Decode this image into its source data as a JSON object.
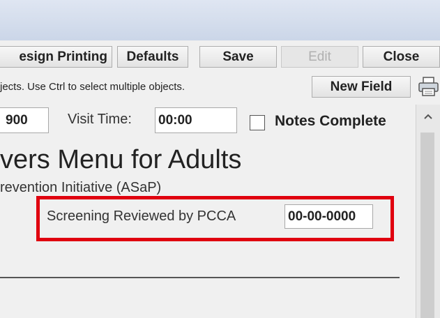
{
  "toolbar": {
    "design_printing_label": "esign Printing",
    "defaults_label": "Defaults",
    "save_label": "Save",
    "edit_label": "Edit",
    "close_label": "Close",
    "hint_text": "jects.  Use Ctrl to select multiple objects.",
    "new_field_label": "New Field",
    "print_icon": "printer-icon"
  },
  "form": {
    "visit_date_value": "900",
    "visit_time_label": "Visit Time:",
    "visit_time_value": "00:00",
    "notes_complete_label": "Notes Complete",
    "notes_complete_checked": false,
    "title": "vers Menu for Adults",
    "subtitle": "revention Initiative (ASaP)",
    "screening_label": "Screening Reviewed by PCCA",
    "screening_value": "00-00-0000"
  },
  "scrollbar": {
    "up_icon": "chevron-up-icon"
  },
  "colors": {
    "highlight": "#e0000f",
    "window_bg": "#f0f0f0"
  }
}
